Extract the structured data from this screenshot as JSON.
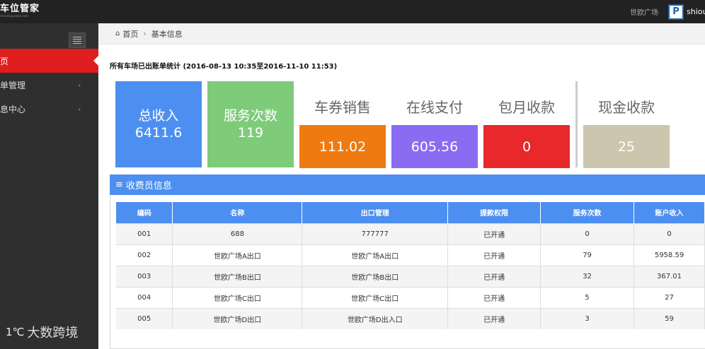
{
  "header": {
    "logo_text": "车位管家",
    "logo_sub": "chewei guanjia.com",
    "park_name": "世欧广场",
    "user_name": "shiou"
  },
  "sidebar": {
    "items": [
      {
        "label": "首页"
      },
      {
        "label": "账单管理"
      },
      {
        "label": "消息中心"
      }
    ],
    "watermark": "大数跨境"
  },
  "breadcrumb": {
    "home": "首页",
    "current": "基本信息"
  },
  "stats": {
    "title": "所有车场已出账单统计 (2016-08-13 10:35至2016-11-10 11:53)",
    "total_income": {
      "label": "总收入",
      "value": "6411.6"
    },
    "service_count": {
      "label": "服务次数",
      "value": "119"
    },
    "coupon_sales": {
      "label": "车券销售",
      "value": "111.02"
    },
    "online_pay": {
      "label": "在线支付",
      "value": "605.56"
    },
    "monthly": {
      "label": "包月收款",
      "value": "0"
    },
    "cash": {
      "label": "现金收款",
      "value": "25"
    },
    "colors": {
      "total": "#4d8ff0",
      "service": "#7ecb7a",
      "coupon": "#ef7a10",
      "online": "#8a6cf3",
      "monthly": "#e8282b",
      "cash": "#cdc6ae"
    }
  },
  "collector_panel": {
    "title": "收费员信息",
    "columns": [
      "编码",
      "名称",
      "出口管理",
      "提款权限",
      "服务次数",
      "账户收入"
    ],
    "rows": [
      [
        "001",
        "688",
        "777777",
        "已开通",
        "0",
        "0"
      ],
      [
        "002",
        "世欧广场A出口",
        "世欧广场A出口",
        "已开通",
        "79",
        "5958.59"
      ],
      [
        "003",
        "世欧广场B出口",
        "世欧广场B出口",
        "已开通",
        "32",
        "367.01"
      ],
      [
        "004",
        "世欧广场C出口",
        "世欧广场C出口",
        "已开通",
        "5",
        "27"
      ],
      [
        "005",
        "世欧广场D出口",
        "世欧广场D出入口",
        "已开通",
        "3",
        "59"
      ]
    ]
  }
}
